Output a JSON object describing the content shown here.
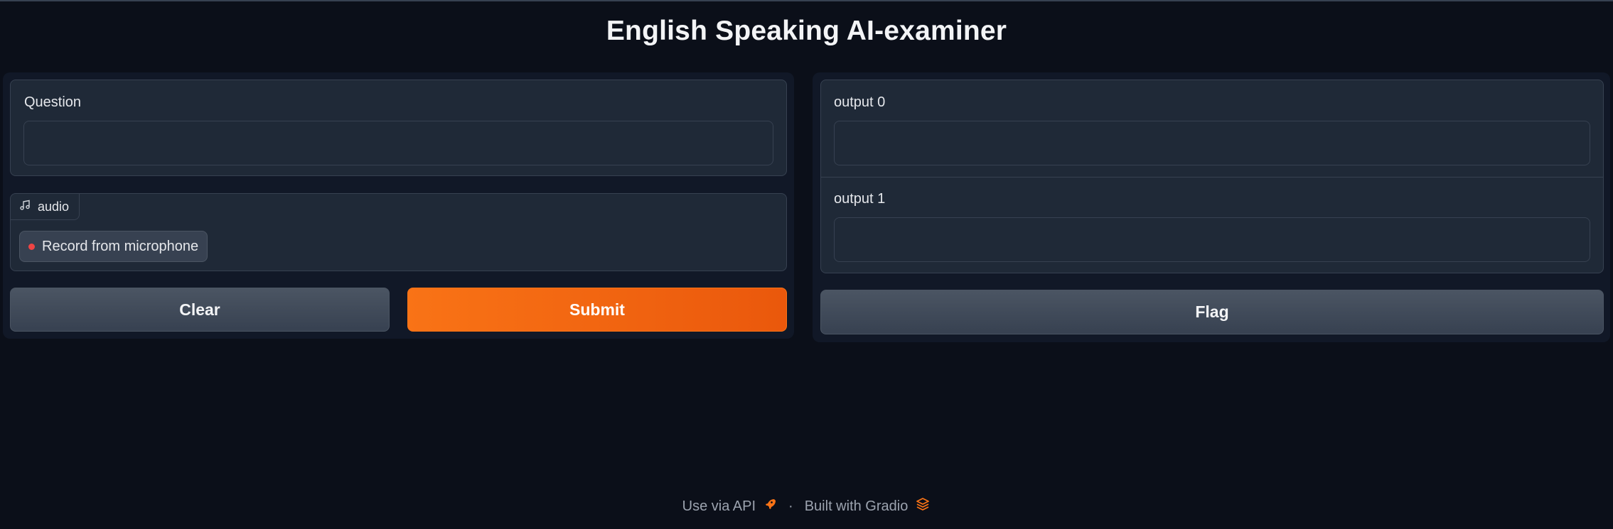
{
  "app": {
    "title": "English Speaking AI-examiner"
  },
  "inputs": {
    "question": {
      "label": "Question",
      "value": "",
      "placeholder": ""
    },
    "audio": {
      "label": "audio",
      "icon": "music-note-icon",
      "record_label": "Record from microphone"
    }
  },
  "actions": {
    "clear_label": "Clear",
    "submit_label": "Submit",
    "flag_label": "Flag"
  },
  "outputs": [
    {
      "label": "output 0",
      "value": ""
    },
    {
      "label": "output 1",
      "value": ""
    }
  ],
  "footer": {
    "api_label": "Use via API",
    "separator": "·",
    "built_label": "Built with Gradio"
  },
  "colors": {
    "background": "#0b0f19",
    "panel": "#111827",
    "block": "#1f2937",
    "border": "#374151",
    "primary": "#f97316",
    "record_dot": "#ef4444"
  }
}
